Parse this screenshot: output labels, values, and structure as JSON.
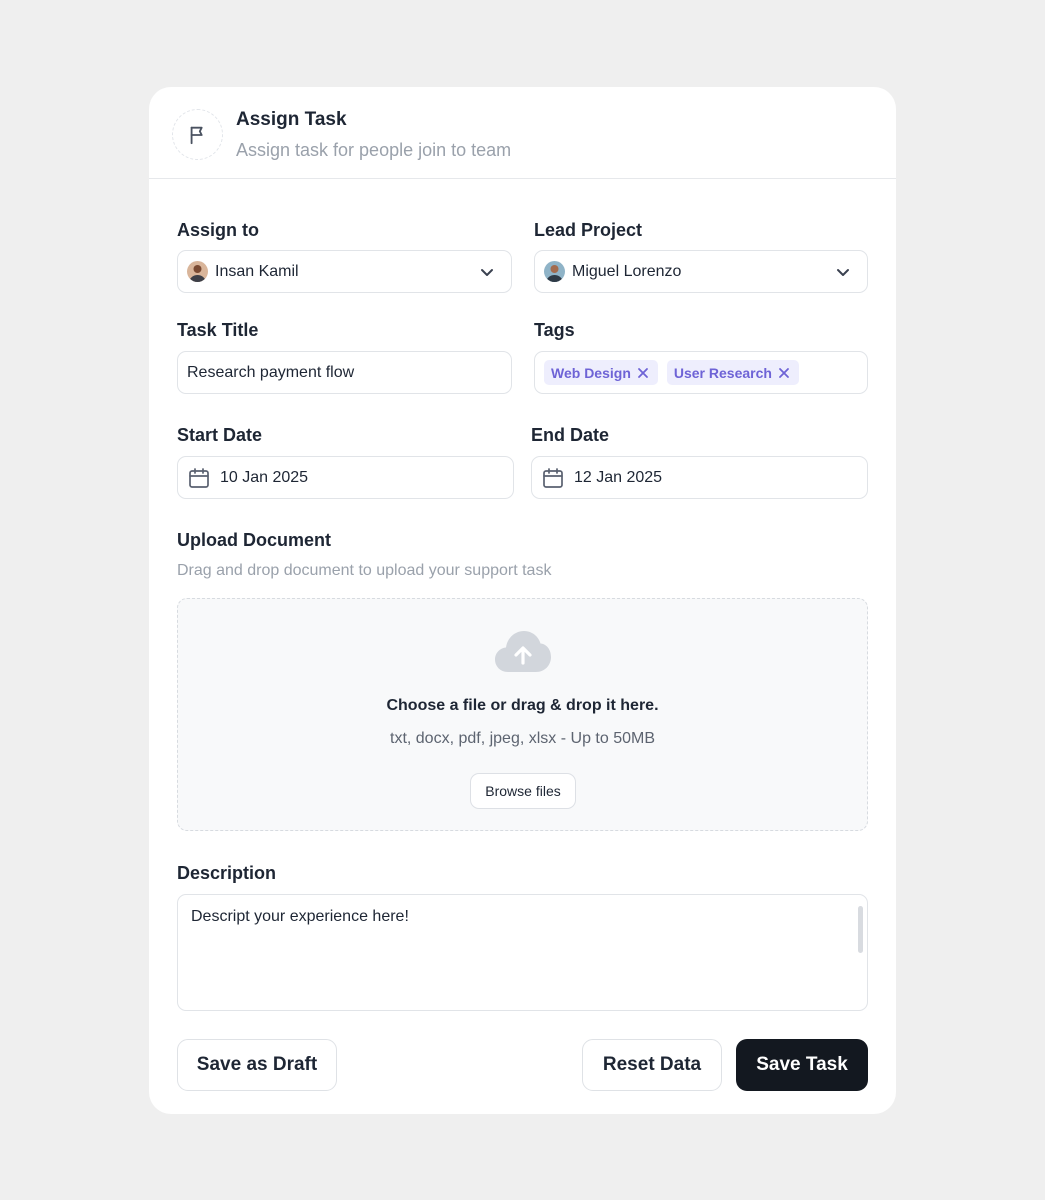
{
  "header": {
    "title": "Assign Task",
    "subtitle": "Assign task for people join to team",
    "icon": "flag-icon"
  },
  "assign_to": {
    "label": "Assign to",
    "value": "Insan Kamil",
    "icon": "chevron-down-icon"
  },
  "lead_project": {
    "label": "Lead Project",
    "value": "Miguel Lorenzo",
    "icon": "chevron-down-icon"
  },
  "task_title": {
    "label": "Task Title",
    "value": "Research payment flow"
  },
  "tags": {
    "label": "Tags",
    "items": [
      {
        "label": "Web Design"
      },
      {
        "label": "User Research"
      }
    ],
    "color": "#6e63d6",
    "background": "#eeeefd"
  },
  "start_date": {
    "label": "Start Date",
    "value": "10 Jan 2025",
    "icon": "calendar-icon"
  },
  "end_date": {
    "label": "End Date",
    "value": "12 Jan 2025",
    "icon": "calendar-icon"
  },
  "upload": {
    "label": "Upload Document",
    "subtitle": "Drag and drop document to upload your support task",
    "drop_title": "Choose a file or drag & drop it here.",
    "drop_hint": "txt, docx, pdf, jpeg, xlsx - Up to 50MB",
    "browse_label": "Browse files",
    "icon": "cloud-upload-icon"
  },
  "description": {
    "label": "Description",
    "value": "Descript your experience here!"
  },
  "actions": {
    "draft_label": "Save as Draft",
    "reset_label": "Reset Data",
    "save_label": "Save Task",
    "save_color": "#131820"
  }
}
